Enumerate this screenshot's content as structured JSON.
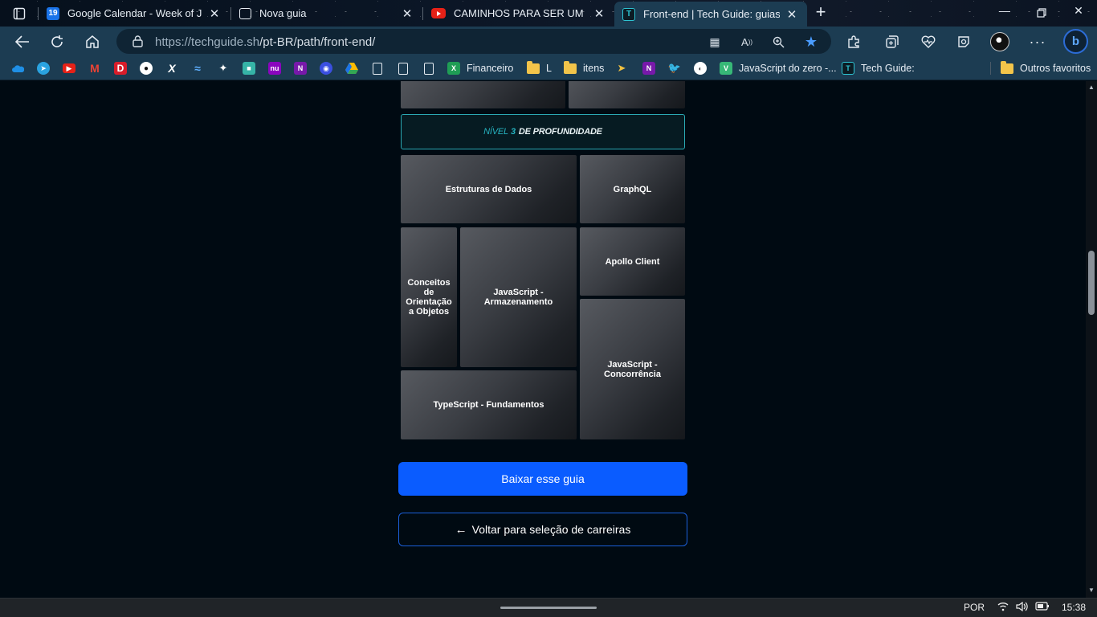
{
  "browser": {
    "tabs": [
      {
        "title": "Google Calendar - Week of June",
        "favicon": "calendar-icon",
        "active": false
      },
      {
        "title": "Nova guia",
        "favicon": "new-tab-icon",
        "active": false
      },
      {
        "title": "CAMINHOS PARA SER UM DEV F",
        "favicon": "youtube-icon",
        "active": false
      },
      {
        "title": "Front-end | Tech Guide: guias do",
        "favicon": "techguide-icon",
        "active": true
      }
    ],
    "calendar_day": "19",
    "url_host": "https://techguide.sh",
    "url_path": "/pt-BR/path/front-end/",
    "bookmarks": [
      {
        "label": "Financeiro",
        "icon": "excel-icon",
        "color": "#1f9d55"
      },
      {
        "label": "L",
        "icon": "folder-icon"
      },
      {
        "label": "itens",
        "icon": "folder-icon"
      },
      {
        "label": "JavaScript do zero -...",
        "icon": "vue-icon",
        "color": "#37b877"
      },
      {
        "label": "Tech Guide:",
        "icon": "techguide-icon"
      },
      {
        "label": "Outros favoritos",
        "icon": "folder-icon"
      }
    ]
  },
  "page": {
    "level_label_prefix": "NÍVEL",
    "level_number": "3",
    "level_label_suffix": "DE PROFUNDIDADE",
    "tiles": [
      "Estruturas de Dados",
      "GraphQL",
      "Conceitos de Orientação a Objetos",
      "JavaScript - Armazenamento",
      "Apollo Client",
      "JavaScript - Concorrência",
      "TypeScript - Fundamentos"
    ],
    "download_button": "Baixar esse guia",
    "back_arrow": "←",
    "back_button": "Voltar para seleção de carreiras"
  },
  "taskbar": {
    "language": "POR",
    "time": "15:38"
  },
  "colors": {
    "accent_blue": "#0a5cff",
    "level_teal": "#26b3c0",
    "page_bg": "#000a12"
  }
}
